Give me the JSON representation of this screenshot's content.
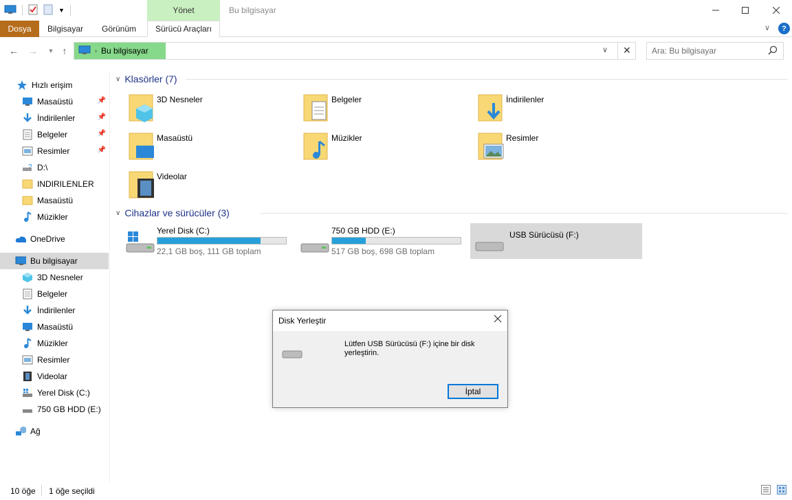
{
  "window": {
    "title": "Bu bilgisayar",
    "context_tab_group": "Yönet"
  },
  "ribbon": {
    "tabs": [
      "Dosya",
      "Bilgisayar",
      "Görünüm",
      "Sürücü Araçları"
    ]
  },
  "address": {
    "breadcrumb": "Bu bilgisayar",
    "search_placeholder": "Ara: Bu bilgisayar"
  },
  "sidebar": {
    "quick_access": "Hızlı erişim",
    "quick_items": [
      "Masaüstü",
      "İndirilenler",
      "Belgeler",
      "Resimler",
      "D:\\",
      "INDIRILENLER",
      "Masaüstü",
      "Müzikler"
    ],
    "onedrive": "OneDrive",
    "this_pc": "Bu bilgisayar",
    "pc_items": [
      "3D Nesneler",
      "Belgeler",
      "İndirilenler",
      "Masaüstü",
      "Müzikler",
      "Resimler",
      "Videolar",
      "Yerel Disk (C:)",
      "750 GB HDD (E:)"
    ],
    "network": "Ağ"
  },
  "content": {
    "folders_header": "Klasörler (7)",
    "folders": [
      "3D Nesneler",
      "Belgeler",
      "İndirilenler",
      "Masaüstü",
      "Müzikler",
      "Resimler",
      "Videolar"
    ],
    "devices_header": "Cihazlar ve sürücüler (3)",
    "drives": [
      {
        "name": "Yerel Disk (C:)",
        "info": "22,1 GB boş, 111 GB toplam",
        "used_fraction": 0.8
      },
      {
        "name": "750 GB HDD (E:)",
        "info": "517 GB boş, 698 GB toplam",
        "used_fraction": 0.26
      },
      {
        "name": "USB Sürücüsü (F:)"
      }
    ]
  },
  "dialog": {
    "title": "Disk Yerleştir",
    "message": "Lütfen USB Sürücüsü (F:) içine bir disk yerleştirin.",
    "cancel_label": "İptal"
  },
  "status": {
    "item_count": "10 öğe",
    "selected_count": "1 öğe seçildi"
  },
  "colors": {
    "file_tab": "#b56c1b",
    "context_tab": "#c9f0c0",
    "progress": "#26a0da",
    "header_text": "#1e3287"
  }
}
